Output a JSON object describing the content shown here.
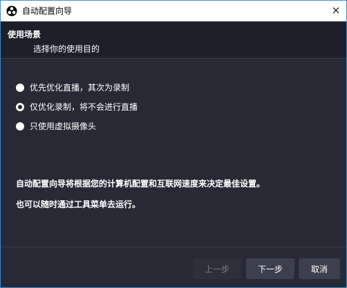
{
  "window": {
    "title": "自动配置向导",
    "logo_icon": "obs-logo-icon",
    "close_icon": "close-icon"
  },
  "header": {
    "title": "使用场景",
    "subtitle": "选择你的使用目的"
  },
  "options": [
    {
      "label": "优先优化直播，其次为录制",
      "selected": false
    },
    {
      "label": "仅优化录制，将不会进行直播",
      "selected": true
    },
    {
      "label": "只使用虚拟摄像头",
      "selected": false
    }
  ],
  "info": {
    "line1": "自动配置向导将根据您的计算机配置和互联网速度来决定最佳设置。",
    "line2": "也可以随时通过工具菜单去运行。"
  },
  "footer": {
    "back_label": "上一步",
    "back_disabled": true,
    "next_label": "下一步",
    "cancel_label": "取消"
  },
  "colors": {
    "accent_border": "#3a8fd6",
    "panel_bg": "#272935",
    "header_bg": "#1e1f29",
    "button_bg": "#3c404d"
  }
}
